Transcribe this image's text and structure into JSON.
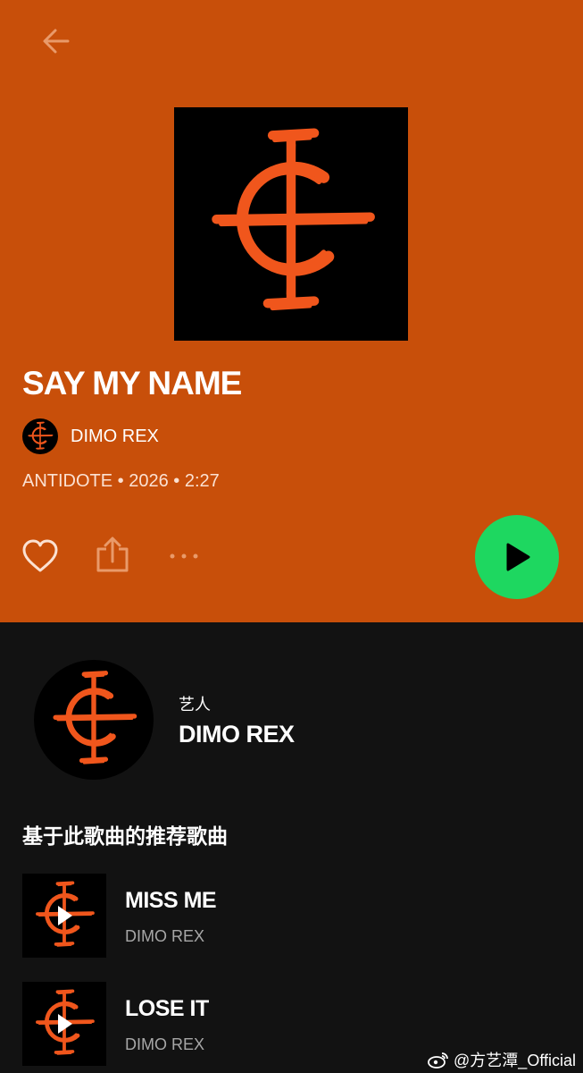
{
  "colors": {
    "header_bg": "#c84f0a",
    "body_bg": "#121212",
    "accent_orange": "#f0561c",
    "play_green": "#1ed760"
  },
  "header": {
    "back_icon": "arrow-left-icon"
  },
  "track": {
    "title": "SAY MY NAME",
    "artist": "DIMO REX",
    "meta": "ANTIDOTE • 2026 • 2:27"
  },
  "actions": {
    "like_icon": "heart-icon",
    "share_icon": "share-icon",
    "more_icon": "more-dots-icon",
    "play_icon": "play-icon"
  },
  "artist_section": {
    "label": "艺人",
    "name": "DIMO REX"
  },
  "recommendations": {
    "heading": "基于此歌曲的推荐歌曲",
    "items": [
      {
        "title": "MISS ME",
        "artist": "DIMO REX"
      },
      {
        "title": "LOSE IT",
        "artist": "DIMO REX"
      }
    ]
  },
  "watermark": "@方艺潭_Official"
}
